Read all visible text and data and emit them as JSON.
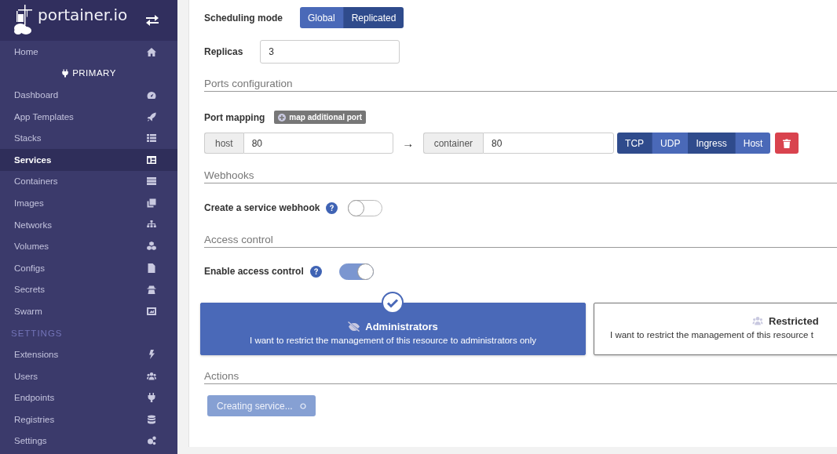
{
  "sidebar": {
    "logo": "portainer.io",
    "items": [
      {
        "kind": "item",
        "label": "Home",
        "selected": false
      },
      {
        "kind": "heading",
        "label": "PRIMARY"
      },
      {
        "kind": "item",
        "label": "Dashboard",
        "selected": false
      },
      {
        "kind": "item",
        "label": "App Templates",
        "selected": false
      },
      {
        "kind": "item",
        "label": "Stacks",
        "selected": false
      },
      {
        "kind": "item",
        "label": "Services",
        "selected": true
      },
      {
        "kind": "item",
        "label": "Containers",
        "selected": false
      },
      {
        "kind": "item",
        "label": "Images",
        "selected": false
      },
      {
        "kind": "item",
        "label": "Networks",
        "selected": false
      },
      {
        "kind": "item",
        "label": "Volumes",
        "selected": false
      },
      {
        "kind": "item",
        "label": "Configs",
        "selected": false
      },
      {
        "kind": "item",
        "label": "Secrets",
        "selected": false
      },
      {
        "kind": "item",
        "label": "Swarm",
        "selected": false
      },
      {
        "kind": "section",
        "label": "SETTINGS"
      },
      {
        "kind": "item",
        "label": "Extensions",
        "selected": false
      },
      {
        "kind": "item",
        "label": "Users",
        "selected": false
      },
      {
        "kind": "item",
        "label": "Endpoints",
        "selected": false
      },
      {
        "kind": "item",
        "label": "Registries",
        "selected": false
      },
      {
        "kind": "item",
        "label": "Settings",
        "selected": false
      }
    ]
  },
  "scheduling_mode": {
    "label": "Scheduling mode",
    "options": [
      {
        "label": "Global",
        "selected": false
      },
      {
        "label": "Replicated",
        "selected": true
      }
    ]
  },
  "replicas": {
    "label": "Replicas",
    "value": "3"
  },
  "ports_configuration": {
    "title": "Ports configuration",
    "label": "Port mapping",
    "add_button": "map additional port",
    "mapping": {
      "host_label": "host",
      "host_value": "80",
      "arrow": "→",
      "container_label": "container",
      "container_value": "80",
      "protocol": [
        {
          "label": "TCP",
          "selected": true
        },
        {
          "label": "UDP",
          "selected": false
        }
      ],
      "mode": [
        {
          "label": "Ingress",
          "selected": true
        },
        {
          "label": "Host",
          "selected": false
        }
      ]
    }
  },
  "webhooks": {
    "title": "Webhooks",
    "label": "Create a service webhook",
    "on": false
  },
  "access_control": {
    "title": "Access control",
    "label": "Enable access control",
    "on": true,
    "options": [
      {
        "title": "Administrators",
        "description": "I want to restrict the management of this resource to administrators only",
        "selected": true
      },
      {
        "title": "Restricted",
        "description": "I want to restrict the management of this resource t",
        "selected": false
      }
    ]
  },
  "actions": {
    "title": "Actions",
    "button": "Creating service...",
    "disabled": true
  }
}
